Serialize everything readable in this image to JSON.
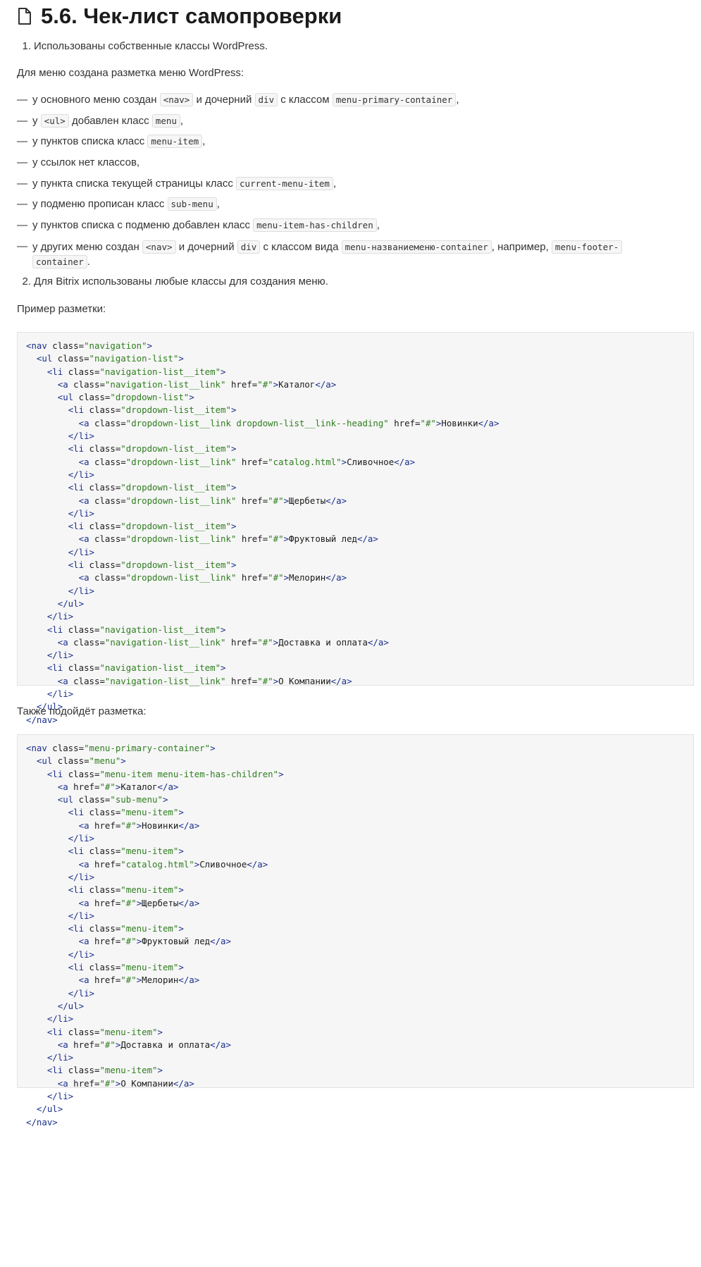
{
  "title": "5.6. Чек-лист самопроверки",
  "item1": {
    "number": "1.",
    "text": "Использованы собственные классы WordPress."
  },
  "menu_intro": "Для меню создана разметка меню WordPress:",
  "bullets": [
    [
      {
        "t": "у основного меню создан "
      },
      {
        "c": "<nav>"
      },
      {
        "t": " и дочерний "
      },
      {
        "c": "div"
      },
      {
        "t": " с классом "
      },
      {
        "c": "menu-primary-container"
      },
      {
        "t": ","
      }
    ],
    [
      {
        "t": "у "
      },
      {
        "c": "<ul>"
      },
      {
        "t": " добавлен класс "
      },
      {
        "c": "menu"
      },
      {
        "t": ","
      }
    ],
    [
      {
        "t": "у пунктов списка класс "
      },
      {
        "c": "menu-item"
      },
      {
        "t": ","
      }
    ],
    [
      {
        "t": "у ссылок нет классов,"
      }
    ],
    [
      {
        "t": "у пункта списка текущей страницы класс "
      },
      {
        "c": "current-menu-item"
      },
      {
        "t": ","
      }
    ],
    [
      {
        "t": "у подменю прописан класс "
      },
      {
        "c": "sub-menu"
      },
      {
        "t": ","
      }
    ],
    [
      {
        "t": "у пунктов списка с подменю добавлен класс "
      },
      {
        "c": "menu-item-has-children"
      },
      {
        "t": ","
      }
    ],
    [
      {
        "t": "у других меню создан "
      },
      {
        "c": "<nav>"
      },
      {
        "t": " и дочерний "
      },
      {
        "c": "div"
      },
      {
        "t": " с классом вида "
      },
      {
        "c": "menu-названиеменю-container"
      },
      {
        "t": ", например, "
      },
      {
        "c": "menu-footer-"
      },
      {
        "br": true
      },
      {
        "c": "container"
      },
      {
        "t": "."
      }
    ]
  ],
  "item2": {
    "number": "2.",
    "text": "Для Bitrix использованы любые классы для создания меню."
  },
  "example_label": "Пример разметки:",
  "also_label": "Также подойдёт разметка:",
  "code1": [
    [
      {
        "i": 0
      },
      {
        "tg": "<nav"
      },
      {
        "at": " class="
      },
      {
        "st": "\"navigation\""
      },
      {
        "tg": ">"
      }
    ],
    [
      {
        "i": 1
      },
      {
        "tg": "<ul"
      },
      {
        "at": " class="
      },
      {
        "st": "\"navigation-list\""
      },
      {
        "tg": ">"
      }
    ],
    [
      {
        "i": 2
      },
      {
        "tg": "<li"
      },
      {
        "at": " class="
      },
      {
        "st": "\"navigation-list__item\""
      },
      {
        "tg": ">"
      }
    ],
    [
      {
        "i": 3
      },
      {
        "tg": "<a"
      },
      {
        "at": " class="
      },
      {
        "st": "\"navigation-list__link\""
      },
      {
        "at": " href="
      },
      {
        "st": "\"#\""
      },
      {
        "tg": ">"
      },
      {
        "tx": "Каталог"
      },
      {
        "tg": "</a>"
      }
    ],
    [
      {
        "i": 3
      },
      {
        "tg": "<ul"
      },
      {
        "at": " class="
      },
      {
        "st": "\"dropdown-list\""
      },
      {
        "tg": ">"
      }
    ],
    [
      {
        "i": 4
      },
      {
        "tg": "<li"
      },
      {
        "at": " class="
      },
      {
        "st": "\"dropdown-list__item\""
      },
      {
        "tg": ">"
      }
    ],
    [
      {
        "i": 5
      },
      {
        "tg": "<a"
      },
      {
        "at": " class="
      },
      {
        "st": "\"dropdown-list__link dropdown-list__link--heading\""
      },
      {
        "at": " href="
      },
      {
        "st": "\"#\""
      },
      {
        "tg": ">"
      },
      {
        "tx": "Новинки"
      },
      {
        "tg": "</a>"
      }
    ],
    [
      {
        "i": 4
      },
      {
        "tg": "</li>"
      }
    ],
    [
      {
        "i": 4
      },
      {
        "tg": "<li"
      },
      {
        "at": " class="
      },
      {
        "st": "\"dropdown-list__item\""
      },
      {
        "tg": ">"
      }
    ],
    [
      {
        "i": 5
      },
      {
        "tg": "<a"
      },
      {
        "at": " class="
      },
      {
        "st": "\"dropdown-list__link\""
      },
      {
        "at": " href="
      },
      {
        "st": "\"catalog.html\""
      },
      {
        "tg": ">"
      },
      {
        "tx": "Сливочное"
      },
      {
        "tg": "</a>"
      }
    ],
    [
      {
        "i": 4
      },
      {
        "tg": "</li>"
      }
    ],
    [
      {
        "i": 4
      },
      {
        "tg": "<li"
      },
      {
        "at": " class="
      },
      {
        "st": "\"dropdown-list__item\""
      },
      {
        "tg": ">"
      }
    ],
    [
      {
        "i": 5
      },
      {
        "tg": "<a"
      },
      {
        "at": " class="
      },
      {
        "st": "\"dropdown-list__link\""
      },
      {
        "at": " href="
      },
      {
        "st": "\"#\""
      },
      {
        "tg": ">"
      },
      {
        "tx": "Щербеты"
      },
      {
        "tg": "</a>"
      }
    ],
    [
      {
        "i": 4
      },
      {
        "tg": "</li>"
      }
    ],
    [
      {
        "i": 4
      },
      {
        "tg": "<li"
      },
      {
        "at": " class="
      },
      {
        "st": "\"dropdown-list__item\""
      },
      {
        "tg": ">"
      }
    ],
    [
      {
        "i": 5
      },
      {
        "tg": "<a"
      },
      {
        "at": " class="
      },
      {
        "st": "\"dropdown-list__link\""
      },
      {
        "at": " href="
      },
      {
        "st": "\"#\""
      },
      {
        "tg": ">"
      },
      {
        "tx": "Фруктовый лед"
      },
      {
        "tg": "</a>"
      }
    ],
    [
      {
        "i": 4
      },
      {
        "tg": "</li>"
      }
    ],
    [
      {
        "i": 4
      },
      {
        "tg": "<li"
      },
      {
        "at": " class="
      },
      {
        "st": "\"dropdown-list__item\""
      },
      {
        "tg": ">"
      }
    ],
    [
      {
        "i": 5
      },
      {
        "tg": "<a"
      },
      {
        "at": " class="
      },
      {
        "st": "\"dropdown-list__link\""
      },
      {
        "at": " href="
      },
      {
        "st": "\"#\""
      },
      {
        "tg": ">"
      },
      {
        "tx": "Мелорин"
      },
      {
        "tg": "</a>"
      }
    ],
    [
      {
        "i": 4
      },
      {
        "tg": "</li>"
      }
    ],
    [
      {
        "i": 3
      },
      {
        "tg": "</ul>"
      }
    ],
    [
      {
        "i": 2
      },
      {
        "tg": "</li>"
      }
    ],
    [
      {
        "i": 2
      },
      {
        "tg": "<li"
      },
      {
        "at": " class="
      },
      {
        "st": "\"navigation-list__item\""
      },
      {
        "tg": ">"
      }
    ],
    [
      {
        "i": 3
      },
      {
        "tg": "<a"
      },
      {
        "at": " class="
      },
      {
        "st": "\"navigation-list__link\""
      },
      {
        "at": " href="
      },
      {
        "st": "\"#\""
      },
      {
        "tg": ">"
      },
      {
        "tx": "Доставка и оплата"
      },
      {
        "tg": "</a>"
      }
    ],
    [
      {
        "i": 2
      },
      {
        "tg": "</li>"
      }
    ],
    [
      {
        "i": 2
      },
      {
        "tg": "<li"
      },
      {
        "at": " class="
      },
      {
        "st": "\"navigation-list__item\""
      },
      {
        "tg": ">"
      }
    ],
    [
      {
        "i": 3
      },
      {
        "tg": "<a"
      },
      {
        "at": " class="
      },
      {
        "st": "\"navigation-list__link\""
      },
      {
        "at": " href="
      },
      {
        "st": "\"#\""
      },
      {
        "tg": ">"
      },
      {
        "tx": "О Компании"
      },
      {
        "tg": "</a>"
      }
    ],
    [
      {
        "i": 2
      },
      {
        "tg": "</li>"
      }
    ],
    [
      {
        "i": 1
      },
      {
        "tg": "</ul>"
      }
    ],
    [
      {
        "i": 0
      },
      {
        "tg": "</nav>"
      }
    ]
  ],
  "code2": [
    [
      {
        "i": 0
      },
      {
        "tg": "<nav"
      },
      {
        "at": " class="
      },
      {
        "st": "\"menu-primary-container\""
      },
      {
        "tg": ">"
      }
    ],
    [
      {
        "i": 1
      },
      {
        "tg": "<ul"
      },
      {
        "at": " class="
      },
      {
        "st": "\"menu\""
      },
      {
        "tg": ">"
      }
    ],
    [
      {
        "i": 2
      },
      {
        "tg": "<li"
      },
      {
        "at": " class="
      },
      {
        "st": "\"menu-item menu-item-has-children\""
      },
      {
        "tg": ">"
      }
    ],
    [
      {
        "i": 3
      },
      {
        "tg": "<a"
      },
      {
        "at": " href="
      },
      {
        "st": "\"#\""
      },
      {
        "tg": ">"
      },
      {
        "tx": "Каталог"
      },
      {
        "tg": "</a>"
      }
    ],
    [
      {
        "i": 3
      },
      {
        "tg": "<ul"
      },
      {
        "at": " class="
      },
      {
        "st": "\"sub-menu\""
      },
      {
        "tg": ">"
      }
    ],
    [
      {
        "i": 4
      },
      {
        "tg": "<li"
      },
      {
        "at": " class="
      },
      {
        "st": "\"menu-item\""
      },
      {
        "tg": ">"
      }
    ],
    [
      {
        "i": 5
      },
      {
        "tg": "<a"
      },
      {
        "at": " href="
      },
      {
        "st": "\"#\""
      },
      {
        "tg": ">"
      },
      {
        "tx": "Новинки"
      },
      {
        "tg": "</a>"
      }
    ],
    [
      {
        "i": 4
      },
      {
        "tg": "</li>"
      }
    ],
    [
      {
        "i": 4
      },
      {
        "tg": "<li"
      },
      {
        "at": " class="
      },
      {
        "st": "\"menu-item\""
      },
      {
        "tg": ">"
      }
    ],
    [
      {
        "i": 5
      },
      {
        "tg": "<a"
      },
      {
        "at": " href="
      },
      {
        "st": "\"catalog.html\""
      },
      {
        "tg": ">"
      },
      {
        "tx": "Сливочное"
      },
      {
        "tg": "</a>"
      }
    ],
    [
      {
        "i": 4
      },
      {
        "tg": "</li>"
      }
    ],
    [
      {
        "i": 4
      },
      {
        "tg": "<li"
      },
      {
        "at": " class="
      },
      {
        "st": "\"menu-item\""
      },
      {
        "tg": ">"
      }
    ],
    [
      {
        "i": 5
      },
      {
        "tg": "<a"
      },
      {
        "at": " href="
      },
      {
        "st": "\"#\""
      },
      {
        "tg": ">"
      },
      {
        "tx": "Щербеты"
      },
      {
        "tg": "</a>"
      }
    ],
    [
      {
        "i": 4
      },
      {
        "tg": "</li>"
      }
    ],
    [
      {
        "i": 4
      },
      {
        "tg": "<li"
      },
      {
        "at": " class="
      },
      {
        "st": "\"menu-item\""
      },
      {
        "tg": ">"
      }
    ],
    [
      {
        "i": 5
      },
      {
        "tg": "<a"
      },
      {
        "at": " href="
      },
      {
        "st": "\"#\""
      },
      {
        "tg": ">"
      },
      {
        "tx": "Фруктовый лед"
      },
      {
        "tg": "</a>"
      }
    ],
    [
      {
        "i": 4
      },
      {
        "tg": "</li>"
      }
    ],
    [
      {
        "i": 4
      },
      {
        "tg": "<li"
      },
      {
        "at": " class="
      },
      {
        "st": "\"menu-item\""
      },
      {
        "tg": ">"
      }
    ],
    [
      {
        "i": 5
      },
      {
        "tg": "<a"
      },
      {
        "at": " href="
      },
      {
        "st": "\"#\""
      },
      {
        "tg": ">"
      },
      {
        "tx": "Мелорин"
      },
      {
        "tg": "</a>"
      }
    ],
    [
      {
        "i": 4
      },
      {
        "tg": "</li>"
      }
    ],
    [
      {
        "i": 3
      },
      {
        "tg": "</ul>"
      }
    ],
    [
      {
        "i": 2
      },
      {
        "tg": "</li>"
      }
    ],
    [
      {
        "i": 2
      },
      {
        "tg": "<li"
      },
      {
        "at": " class="
      },
      {
        "st": "\"menu-item\""
      },
      {
        "tg": ">"
      }
    ],
    [
      {
        "i": 3
      },
      {
        "tg": "<a"
      },
      {
        "at": " href="
      },
      {
        "st": "\"#\""
      },
      {
        "tg": ">"
      },
      {
        "tx": "Доставка и оплата"
      },
      {
        "tg": "</a>"
      }
    ],
    [
      {
        "i": 2
      },
      {
        "tg": "</li>"
      }
    ],
    [
      {
        "i": 2
      },
      {
        "tg": "<li"
      },
      {
        "at": " class="
      },
      {
        "st": "\"menu-item\""
      },
      {
        "tg": ">"
      }
    ],
    [
      {
        "i": 3
      },
      {
        "tg": "<a"
      },
      {
        "at": " href="
      },
      {
        "st": "\"#\""
      },
      {
        "tg": ">"
      },
      {
        "tx": "О Компании"
      },
      {
        "tg": "</a>"
      }
    ],
    [
      {
        "i": 2
      },
      {
        "tg": "</li>"
      }
    ],
    [
      {
        "i": 1
      },
      {
        "tg": "</ul>"
      }
    ],
    [
      {
        "i": 0
      },
      {
        "tg": "</nav>"
      }
    ]
  ]
}
